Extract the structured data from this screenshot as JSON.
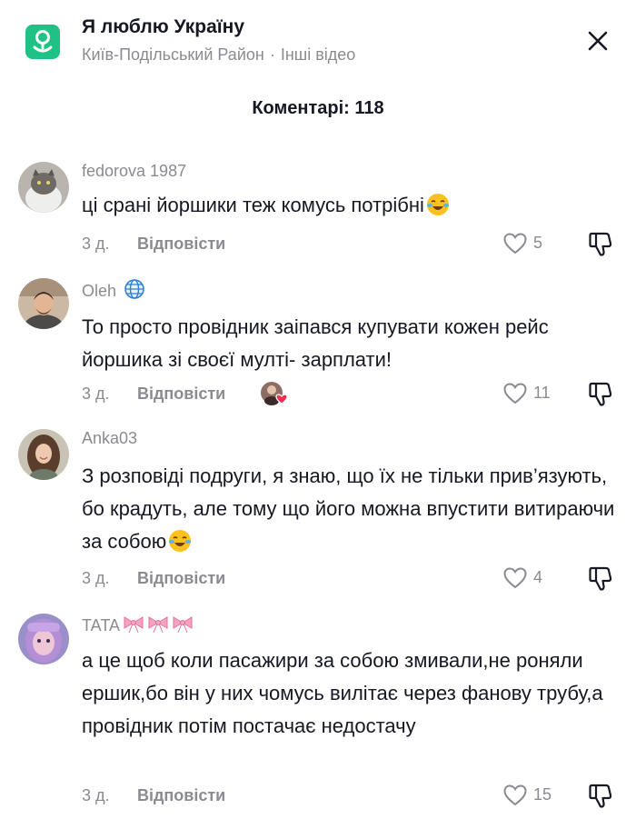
{
  "header": {
    "title": "Я люблю Україну",
    "location": "Київ-Подільський Район",
    "separator": "·",
    "other_videos": "Інші відео",
    "icon": "location-pin-icon",
    "close_icon": "close-icon"
  },
  "comments_count": "Коментарі: 118",
  "reply_label": "Відповісти",
  "colors": {
    "accent": "#20c184",
    "muted": "#8a8b91",
    "text": "#161823"
  },
  "comments": [
    {
      "username": "fedorova 1987",
      "text": "ці срані йоршики теж комусь потрібні",
      "emoji": "laughing-tears-emoji",
      "time": "3 д.",
      "likes": "5"
    },
    {
      "username": "Oleh",
      "badge": "globe-icon",
      "text": "То просто провідник заіпався купувати кожен рейс йоршика зі своєї мулті- зарплати!",
      "time": "3 д.",
      "creator_liked": true,
      "likes": "11"
    },
    {
      "username": "Anka03",
      "text": "З розповіді подруги, я знаю, що їх не тільки прив’язують, бо крадуть, але тому що його можна впустити витираючи за собою",
      "emoji": "laughing-tears-emoji",
      "time": "3 д.",
      "likes": "4"
    },
    {
      "username": "TATA",
      "decoration": "ribbon-bow-emoji x3",
      "text": "а це щоб коли пасажири за собою змивали,не роняли ершик,бо він у них чомусь вилітає через фанову трубу,а провідник потім постачає недостачу",
      "time": "3 д.",
      "likes": "15"
    }
  ]
}
